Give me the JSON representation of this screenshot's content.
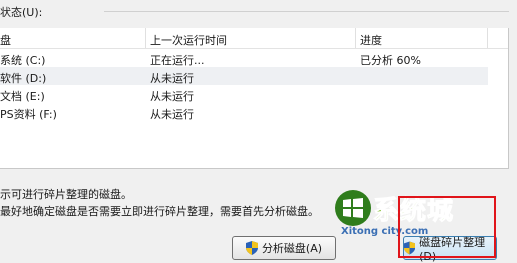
{
  "status": {
    "label": "状态(U):"
  },
  "columns": [
    "盘",
    "上一次运行时间",
    "进度"
  ],
  "rows": [
    {
      "disk": "系统 (C:)",
      "last_run": "正在运行...",
      "progress": "已分析 60%"
    },
    {
      "disk": "软件 (D:)",
      "last_run": "从未运行",
      "progress": ""
    },
    {
      "disk": "文档 (E:)",
      "last_run": "从未运行",
      "progress": ""
    },
    {
      "disk": "PS资料 (F:)",
      "last_run": "从未运行",
      "progress": ""
    }
  ],
  "info": {
    "line1": "示可进行碎片整理的磁盘。",
    "line2": "最好地确定磁盘是否需要立即进行碎片整理，需要首先分析磁盘。"
  },
  "buttons": {
    "analyze": "分析磁盘(A)",
    "defrag": "磁盘碎片整理(D)"
  },
  "watermark": {
    "brand": "系统城",
    "url": "Xitong city.com"
  },
  "colors": {
    "highlight_box": "#e0141a",
    "row_alt": "#eef0f3",
    "watermark_green": "#78b71c"
  }
}
